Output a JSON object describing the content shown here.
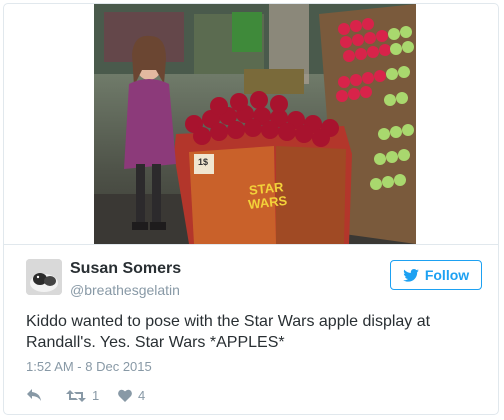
{
  "tweet": {
    "author": {
      "name": "Susan Somers",
      "handle": "@breathesgelatin"
    },
    "follow_label": "Follow",
    "text_line1": "Kiddo wanted to pose with the Star Wars apple display at",
    "text_line2": "Randall's. Yes. Star Wars *APPLES*",
    "timestamp": "1:52 AM - 8 Dec 2015",
    "retweet_count": "1",
    "like_count": "4",
    "display_sign_text": "STAR WARS",
    "price_tag": "1$"
  },
  "icons": {
    "follow": "twitter-bird-icon",
    "reply": "reply-icon",
    "retweet": "retweet-icon",
    "like": "heart-icon"
  },
  "colors": {
    "accent": "#1da1f2",
    "text": "#292f33",
    "muted": "#8899a6",
    "border": "#e1e8ed"
  }
}
